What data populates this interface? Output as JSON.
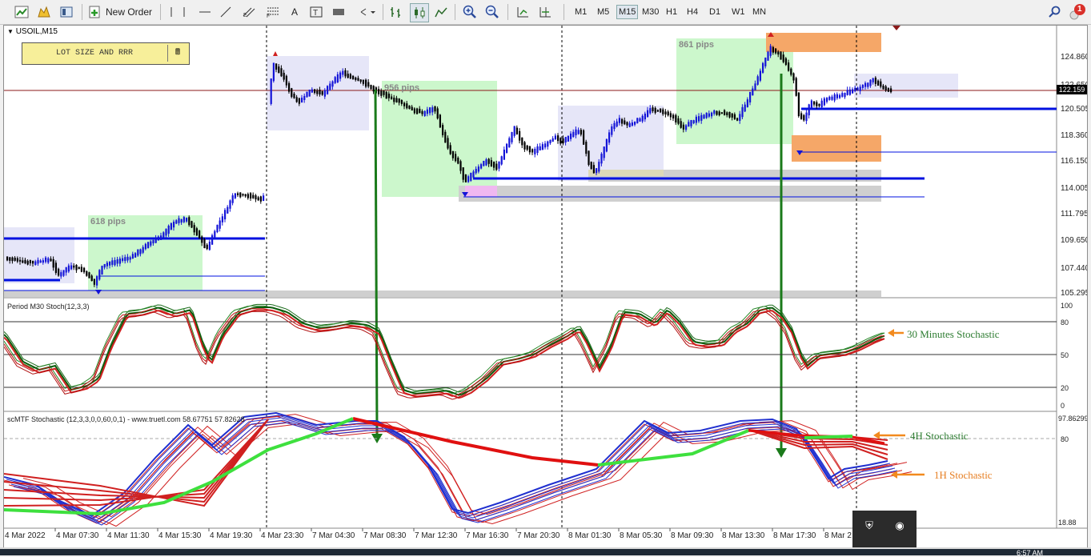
{
  "toolbar": {
    "new_order_label": "New Order",
    "timeframes": [
      "M1",
      "M5",
      "M15",
      "M30",
      "H1",
      "H4",
      "D1",
      "W1",
      "MN"
    ],
    "active_timeframe": "M15",
    "notification_count": "1"
  },
  "chart": {
    "symbol": "USOIL,M15",
    "lot_button_label": "LOT SIZE AND RRR",
    "current_price": "122.159",
    "price_axis": [
      "124.860",
      "122.650",
      "120.505",
      "118.360",
      "116.150",
      "114.005",
      "111.795",
      "109.650",
      "107.440",
      "105.295"
    ],
    "pips_labels": [
      "618 pips",
      "956 pips",
      "861 pips"
    ],
    "time_axis": [
      "4 Mar 2022",
      "4 Mar 07:30",
      "4 Mar 11:30",
      "4 Mar 15:30",
      "4 Mar 19:30",
      "4 Mar 23:30",
      "7 Mar 04:30",
      "7 Mar 08:30",
      "7 Mar 12:30",
      "7 Mar 16:30",
      "7 Mar 20:30",
      "8 Mar 01:30",
      "8 Mar 05:30",
      "8 Mar 09:30",
      "8 Mar 13:30",
      "8 Mar 17:30",
      "8 Mar 2"
    ]
  },
  "stoch1": {
    "title": "Period M30 Stoch(12,3,3)",
    "levels": [
      "100",
      "80",
      "50",
      "20",
      "0"
    ],
    "annotation": "30 Minutes Stochastic"
  },
  "stoch2": {
    "title": "scMTF Stochastic (12,3,3,0,0,60,0,1) - www.truetl.com 58.67751 57.82628",
    "top_value": "97.86299",
    "level_80": "80",
    "bottom_value": "18.88",
    "annotation_4h": "4H Stochastic",
    "annotation_1h": "1H Stochastic"
  },
  "taskbar": {
    "clock": "6:57 AM"
  }
}
